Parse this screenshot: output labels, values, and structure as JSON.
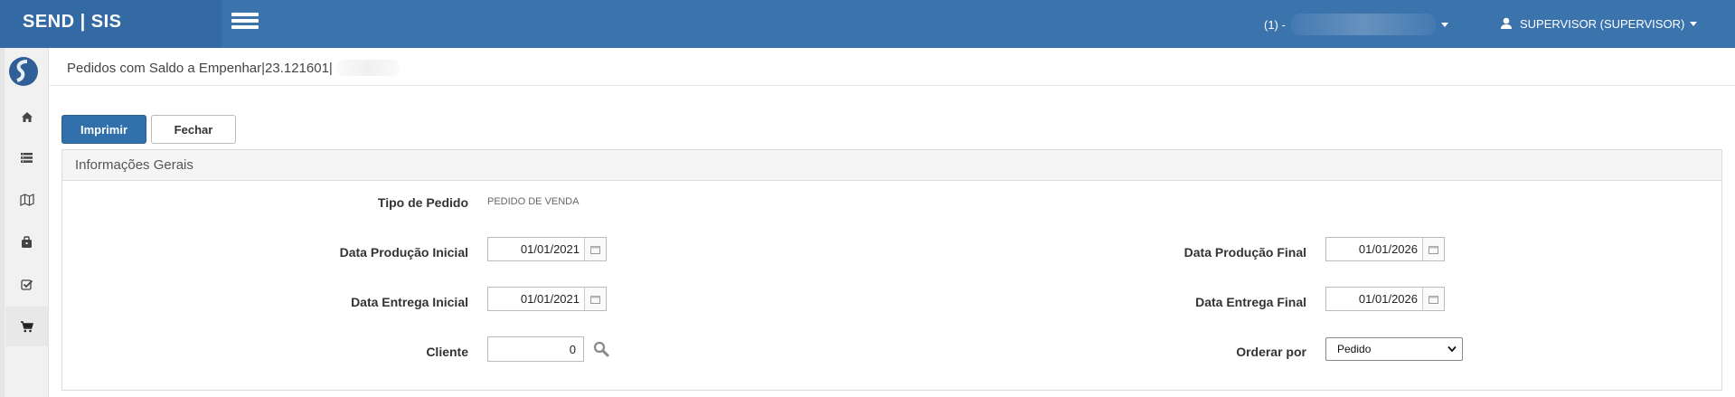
{
  "app": {
    "brand": "SEND | SIS",
    "company_prefix": "(1) -",
    "user": "SUPERVISOR (SUPERVISOR)"
  },
  "sidebar": {
    "items": [
      {
        "icon": "home-icon"
      },
      {
        "icon": "list-icon"
      },
      {
        "icon": "map-icon"
      },
      {
        "icon": "briefcase-icon"
      },
      {
        "icon": "check-square-icon"
      },
      {
        "icon": "cart-icon"
      }
    ]
  },
  "page": {
    "title": "Pedidos com Saldo a Empenhar|23.121601|"
  },
  "toolbar": {
    "print_label": "Imprimir",
    "close_label": "Fechar"
  },
  "panel": {
    "heading": "Informações Gerais",
    "tipo_pedido_label": "Tipo de Pedido",
    "tipo_pedido_value": "PEDIDO DE VENDA",
    "data_producao_inicial_label": "Data Produção Inicial",
    "data_producao_inicial_value": "01/01/2021",
    "data_producao_final_label": "Data Produção Final",
    "data_producao_final_value": "01/01/2026",
    "data_entrega_inicial_label": "Data Entrega Inicial",
    "data_entrega_inicial_value": "01/01/2021",
    "data_entrega_final_label": "Data Entrega Final",
    "data_entrega_final_value": "01/01/2026",
    "cliente_label": "Cliente",
    "cliente_value": "0",
    "ordenar_label": "Orderar por",
    "ordenar_value": "Pedido"
  },
  "colors": {
    "topbar": "#3b73ad",
    "primary_button": "#3170ab"
  }
}
